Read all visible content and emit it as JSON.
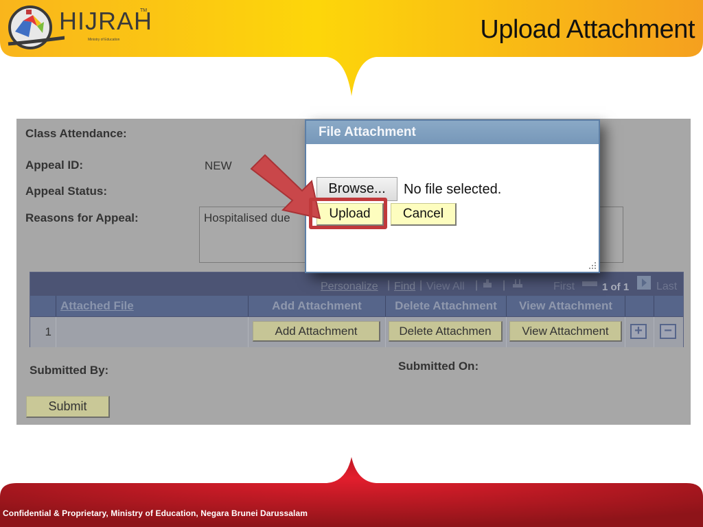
{
  "slide": {
    "title": "Upload Attachment",
    "footer": "Confidential & Proprietary, Ministry of Education, Negara Brunei Darussalam"
  },
  "logo": {
    "name": "HIJRAH",
    "trademark": "TM",
    "tagline": "Ministry of Education"
  },
  "colors": {
    "header_yellow": "#fdd20a",
    "header_orange": "#f5a623",
    "footer_red": "#d42030",
    "highlight_red": "#c0393b",
    "dialog_title_blue": "#7f9fc0",
    "button_yellow": "#fdfdbf",
    "grid_header": "#56658a"
  },
  "form": {
    "class_attendance_label": "Class Attendance:",
    "appeal_id_label": "Appeal ID:",
    "appeal_id_value": "NEW",
    "appeal_status_label": "Appeal Status:",
    "appeal_status_value": "",
    "reasons_label": "Reasons for Appeal:",
    "reasons_value": "Hospitalised due",
    "submitted_by_label": "Submitted By:",
    "submitted_on_label": "Submitted On:",
    "submit_button": "Submit"
  },
  "grid": {
    "nav": {
      "personalize": "Personalize",
      "find": "Find",
      "view_all": "View All",
      "first": "First",
      "count": "1 of 1",
      "last": "Last",
      "separator": "|"
    },
    "columns": [
      "",
      "Attached File",
      "Add Attachment",
      "Delete Attachment",
      "View Attachment",
      "",
      ""
    ],
    "rows": [
      {
        "num": "1",
        "attached_file": "",
        "add_button": "Add Attachment",
        "delete_button": "Delete Attachmen",
        "view_button": "View Attachment",
        "add_row": "+",
        "delete_row": "−"
      }
    ]
  },
  "dialog": {
    "title": "File Attachment",
    "browse_button": "Browse...",
    "file_status": "No file selected.",
    "upload_button": "Upload",
    "cancel_button": "Cancel"
  }
}
